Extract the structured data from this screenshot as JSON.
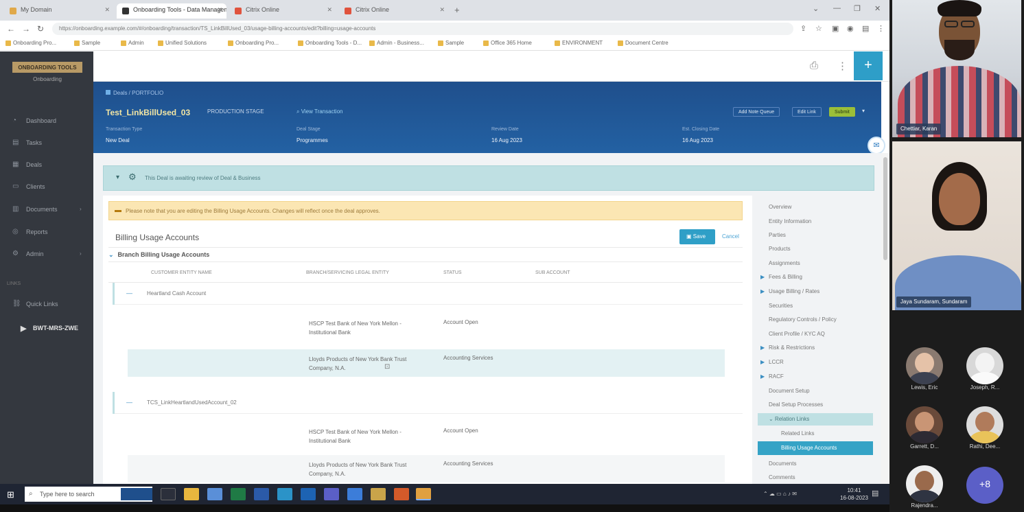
{
  "browser": {
    "tabs": [
      {
        "label": "My Domain",
        "color": "#e0a94a"
      },
      {
        "label": "Onboarding Tools - Data Management",
        "color": "#333333"
      },
      {
        "label": "Citrix Online",
        "color": "#e0533d"
      },
      {
        "label": "Citrix Online",
        "color": "#e0533d"
      }
    ],
    "url": "https://onboarding.example.com/#/onboarding/transaction/TS_LinkBillUsed_03/usage-billing-accounts/edit?billing=usage-accounts",
    "bookmarks": [
      "Onboarding Pro...",
      "Sample",
      "Admin",
      "Unified Solutions",
      "Onboarding Pro...",
      "Onboarding Tools - D...",
      "Admin - Business...",
      "Sample",
      "Office 365 Home",
      "ENVIRONMENT",
      "Document Centre"
    ]
  },
  "sidebar": {
    "logo": "ONBOARDING TOOLS",
    "logo_sub": "Onboarding",
    "items": [
      {
        "label": "Dashboard",
        "icon": "gauge-icon"
      },
      {
        "label": "Tasks",
        "icon": "tasks-icon"
      },
      {
        "label": "Deals",
        "icon": "deals-icon"
      },
      {
        "label": "Clients",
        "icon": "clients-icon"
      },
      {
        "label": "Documents",
        "icon": "documents-icon"
      },
      {
        "label": "Reports",
        "icon": "reports-icon"
      },
      {
        "label": "Admin",
        "icon": "admin-icon"
      }
    ],
    "section": "LINKS",
    "quick_links": "Quick Links",
    "user": "BWT-MRS-ZWE"
  },
  "header": {
    "breadcrumb": "Deals / PORTFOLIO",
    "title": "Test_LinkBillUsed_03",
    "status": "PRODUCTION STAGE",
    "link": "View Transaction",
    "buttons": [
      "Add Note Queue",
      "Edit Link",
      "Submit"
    ],
    "fields": [
      {
        "label": "Transaction Type",
        "value": "New Deal"
      },
      {
        "label": "Deal Stage",
        "value": "Programmes"
      },
      {
        "label": "Review Date",
        "value": "16 Aug 2023"
      },
      {
        "label": "Est. Closing Date",
        "value": "16 Aug 2023"
      }
    ]
  },
  "banner": "This Deal is awaiting review of Deal & Business",
  "warning": "Please note that you are editing the Billing Usage Accounts. Changes will reflect once the deal approves.",
  "section": {
    "title": "Billing Usage Accounts",
    "save": "Save",
    "cancel": "Cancel",
    "subsection": "Branch Billing Usage Accounts",
    "columns": [
      "CUSTOMER ENTITY NAME",
      "BRANCH/SERVICING LEGAL ENTITY",
      "STATUS",
      "SUB ACCOUNT"
    ],
    "groups": [
      {
        "name": "Heartland Cash Account",
        "rows": [
          {
            "entity": "HSCP Test Bank of New York Mellon - Institutional Bank",
            "status": "Account Open"
          },
          {
            "entity": "Lloyds Products of New York Bank Trust Company, N.A.",
            "status": "Accounting Services"
          }
        ]
      },
      {
        "name": "TCS_LinkHeartlandUsedAccount_02",
        "rows": [
          {
            "entity": "HSCP Test Bank of New York Mellon - Institutional Bank",
            "status": "Account Open"
          },
          {
            "entity": "Lloyds Products of New York Bank Trust Company, N.A.",
            "status": "Accounting Services"
          }
        ]
      }
    ]
  },
  "rightnav": {
    "items": [
      {
        "label": "Overview",
        "type": "plain"
      },
      {
        "label": "Entity Information",
        "type": "plain"
      },
      {
        "label": "Parties",
        "type": "plain"
      },
      {
        "label": "Products",
        "type": "plain"
      },
      {
        "label": "Assignments",
        "type": "plain"
      },
      {
        "label": "Fees & Billing",
        "type": "arrow"
      },
      {
        "label": "Usage Billing / Rates",
        "type": "arrow"
      },
      {
        "label": "Securities",
        "type": "plain"
      },
      {
        "label": "Regulatory Controls / Policy",
        "type": "plain"
      },
      {
        "label": "Client Profile / KYC AQ",
        "type": "plain"
      },
      {
        "label": "Risk & Restrictions",
        "type": "arrow"
      },
      {
        "label": "LCCR",
        "type": "arrow"
      },
      {
        "label": "RACF",
        "type": "arrow"
      },
      {
        "label": "Document Setup",
        "type": "plain"
      },
      {
        "label": "Deal Setup Processes",
        "type": "plain"
      },
      {
        "label": "Relation Links",
        "type": "expanded"
      },
      {
        "label": "Related Links",
        "type": "sub"
      },
      {
        "label": "Billing Usage Accounts",
        "type": "active"
      },
      {
        "label": "Documents",
        "type": "plain"
      },
      {
        "label": "Comments",
        "type": "plain"
      }
    ]
  },
  "taskbar": {
    "search_placeholder": "Type here to search",
    "time": "10:41",
    "date": "16-08-2023"
  },
  "meeting": {
    "presenter": "Chettiar, Karan",
    "second": "Jaya Sundaram, Sundaram",
    "participants": [
      {
        "name": "Lewis, Eric"
      },
      {
        "name": "Joseph, R..."
      },
      {
        "name": "Garrett, D..."
      },
      {
        "name": "Rathi, Dee..."
      },
      {
        "name": "Rajendra..."
      }
    ],
    "more": "+8"
  }
}
